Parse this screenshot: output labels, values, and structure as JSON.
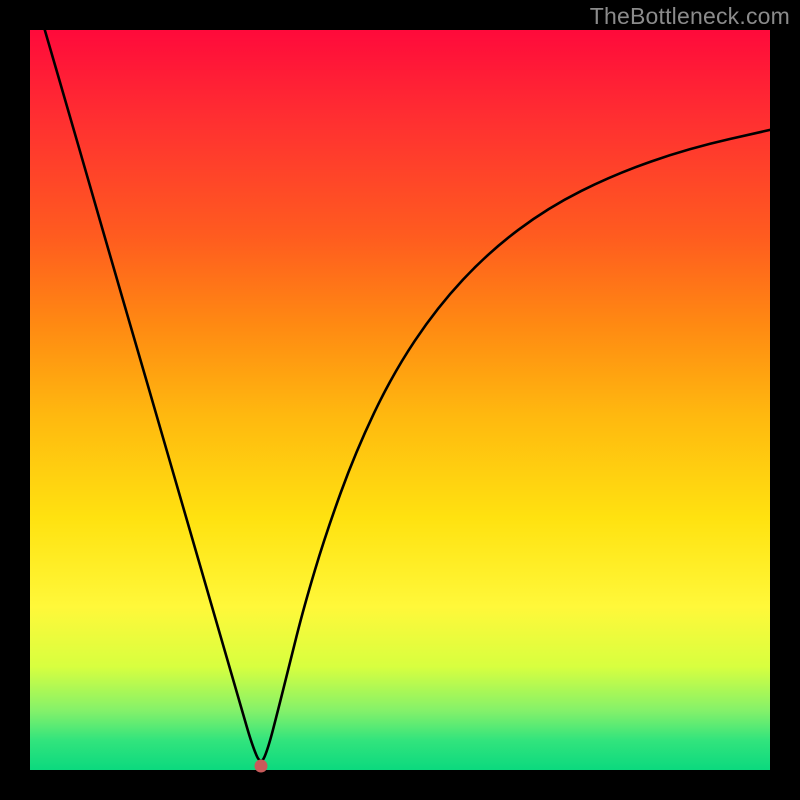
{
  "watermark": "TheBottleneck.com",
  "chart_data": {
    "type": "line",
    "title": "",
    "xlabel": "",
    "ylabel": "",
    "xlim": [
      0,
      100
    ],
    "ylim": [
      0,
      100
    ],
    "grid": false,
    "legend": false,
    "background_gradient_top": "#ff0a3b",
    "background_gradient_bottom": "#0bd97e",
    "marker": {
      "x": 31.2,
      "y": 0.6,
      "color": "#c85a5a"
    },
    "series": [
      {
        "name": "curve",
        "color": "#000000",
        "x": [
          2,
          5,
          8,
          11,
          14,
          17,
          20,
          23,
          26,
          28.5,
          30,
          31.2,
          32.2,
          33.5,
          35,
          37,
          40,
          44,
          49,
          55,
          62,
          70,
          79,
          89,
          100
        ],
        "y": [
          100,
          89.7,
          79.3,
          68.9,
          58.6,
          48.3,
          37.9,
          27.6,
          17.2,
          8.6,
          3.4,
          0.6,
          3.0,
          8.0,
          14.0,
          22.0,
          32.0,
          43.0,
          53.5,
          62.5,
          70.0,
          76.0,
          80.5,
          84.0,
          86.5
        ]
      }
    ]
  }
}
